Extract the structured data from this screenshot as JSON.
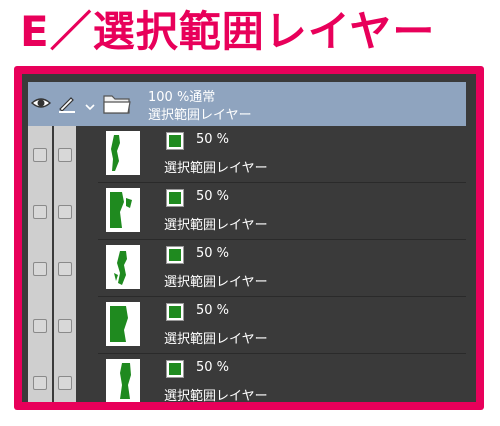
{
  "title": "E／選択範囲レイヤー",
  "colors": {
    "accent": "#e8005a",
    "panel": "#3a3a3a",
    "header": "#8fa4bf",
    "mask_green": "#1f8a1f"
  },
  "header": {
    "opacity_label": "100 %通常",
    "name": "選択範囲レイヤー",
    "icons": [
      "eye-icon",
      "pen-icon",
      "chevron-down-icon",
      "folder-icon"
    ]
  },
  "layers": [
    {
      "opacity": "50 %",
      "name": "選択範囲レイヤー"
    },
    {
      "opacity": "50 %",
      "name": "選択範囲レイヤー"
    },
    {
      "opacity": "50 %",
      "name": "選択範囲レイヤー"
    },
    {
      "opacity": "50 %",
      "name": "選択範囲レイヤー"
    },
    {
      "opacity": "50 %",
      "name": "選択範囲レイヤー"
    }
  ]
}
